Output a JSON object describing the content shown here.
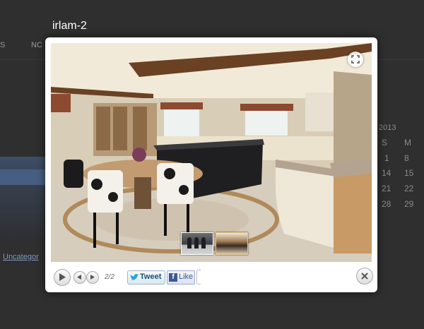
{
  "background": {
    "nav_items": [
      "S",
      "NC"
    ],
    "calendar_year": "2013",
    "calendar_weekday_labels": [
      "S",
      "M"
    ],
    "calendar_days": [
      [
        "1",
        "8"
      ],
      [
        "14",
        "15"
      ],
      [
        "21",
        "22"
      ],
      [
        "28",
        "29"
      ]
    ],
    "category_link": "Uncategor"
  },
  "lightbox": {
    "title": "irlam-2",
    "image_counter": "2/2",
    "tweet_label": "Tweet",
    "like_label": "Like",
    "fb_glyph": "f",
    "icons": {
      "expand": "expand-icon",
      "play": "play-icon",
      "prev": "arrow-left-icon",
      "next": "arrow-right-icon",
      "close": "close-icon",
      "twitter": "twitter-bird-icon",
      "facebook": "facebook-icon"
    }
  },
  "colors": {
    "overlay": "#2f2f2f",
    "twitter_text": "#1f4e6e",
    "facebook_blue": "#3b5998"
  }
}
